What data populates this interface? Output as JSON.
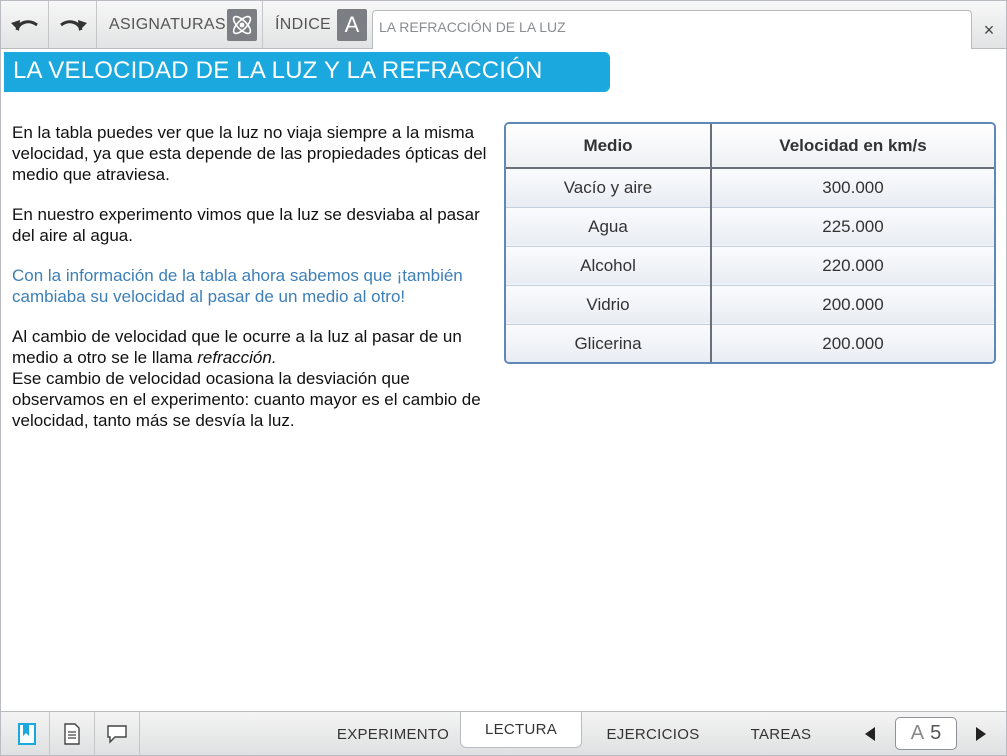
{
  "header": {
    "subjects_label": "ASIGNATURAS",
    "index_label": "ÍNDICE",
    "index_letter": "A",
    "path_title": "LA REFRACCIÓN DE LA LUZ",
    "close_glyph": "×",
    "icons": [
      "undo-icon",
      "redo-icon",
      "atom-icon",
      "close-icon"
    ]
  },
  "page": {
    "title": "LA VELOCIDAD DE LA LUZ Y LA REFRACCIÓN",
    "paragraphs": {
      "p1": "En la tabla puedes ver que la luz no viaja siempre a la misma velocidad, ya que esta depende de las propiedades ópticas del medio que atraviesa.",
      "p2": "En nuestro experimento vimos que la luz se desviaba al pasar del aire al agua.",
      "p3": "Con la información de la tabla ahora sabemos que ¡también cambiaba su velocidad al pasar de un medio al otro!",
      "p4_before": "Al cambio de velocidad que le ocurre a la luz al pasar de un medio a otro se le llama ",
      "p4_term": "refracción.",
      "p4_after": "Ese cambio de velocidad ocasiona la desviación que observamos en el experimento: cuanto mayor es el cambio de velocidad, tanto más se desvía la luz."
    }
  },
  "table": {
    "headers": [
      "Medio",
      "Velocidad en km/s"
    ],
    "rows": [
      [
        "Vacío y aire",
        "300.000"
      ],
      [
        "Agua",
        "225.000"
      ],
      [
        "Alcohol",
        "220.000"
      ],
      [
        "Vidrio",
        "200.000"
      ],
      [
        "Glicerina",
        "200.000"
      ]
    ]
  },
  "footer": {
    "tabs": [
      "EXPERIMENTO",
      "LECTURA",
      "EJERCICIOS",
      "TAREAS"
    ],
    "active_tab": "LECTURA",
    "page_letter": "A",
    "page_number": "5",
    "icons": [
      "bookmark-icon",
      "notes-icon",
      "comment-icon",
      "prev-arrow-icon",
      "next-arrow-icon"
    ]
  },
  "colors": {
    "accent": "#1aa8df",
    "highlight_text": "#3d7fb6",
    "table_border": "#5d88b8",
    "bookmark": "#1aa8df"
  }
}
